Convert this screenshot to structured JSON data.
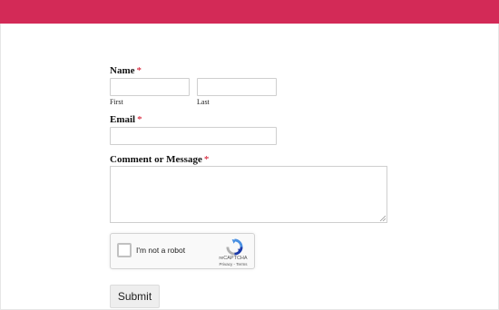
{
  "header": {
    "bar_color": "#d32a57"
  },
  "form": {
    "name": {
      "label": "Name",
      "required_mark": "*",
      "first_sublabel": "First",
      "last_sublabel": "Last",
      "first_value": "",
      "last_value": ""
    },
    "email": {
      "label": "Email",
      "required_mark": "*",
      "value": ""
    },
    "message": {
      "label": "Comment or Message",
      "required_mark": "*",
      "value": ""
    },
    "recaptcha": {
      "checkbox_label": "I'm not a robot",
      "brand": "reCAPTCHA",
      "links": "Privacy - Terms",
      "checked": false
    },
    "submit_label": "Submit"
  },
  "colors": {
    "required": "#d0021b",
    "field_border": "#cfcfcf"
  }
}
